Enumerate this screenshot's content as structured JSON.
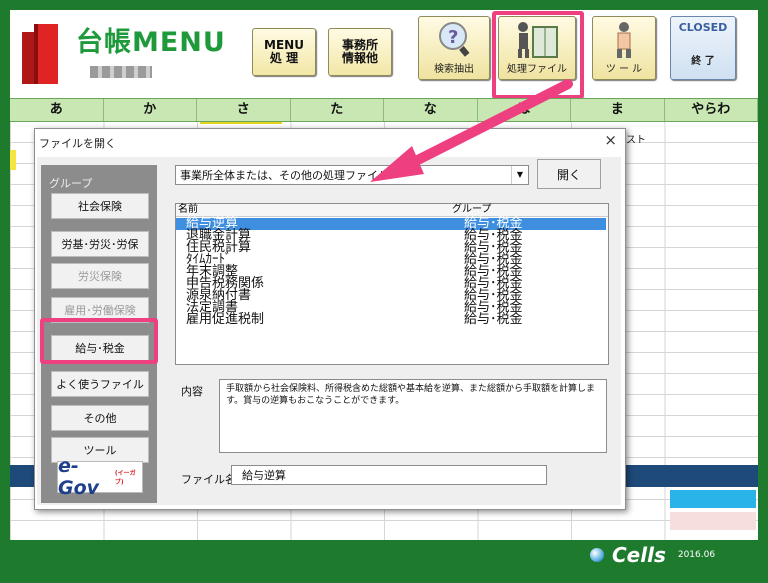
{
  "app": {
    "title": "台帳MENU"
  },
  "toolbar": {
    "menu_label": "MENU\n処 理",
    "office_label": "事務所\n情報他",
    "search_label": "検索抽出",
    "files_label": "処理ファイル",
    "tools_label": "ツ ー ル",
    "closed_label": "CLOSED",
    "exit_label": "終 了"
  },
  "kana_tabs": [
    "あ",
    "か",
    "さ",
    "た",
    "な",
    "は",
    "ま",
    "やらわ"
  ],
  "grid": {
    "partial_text": "スト"
  },
  "dialog": {
    "title": "ファイルを開く",
    "close": "×",
    "group_label": "グループ",
    "groups": [
      {
        "label": "社会保険",
        "enabled": true
      },
      {
        "label": "労基･労災･労保",
        "enabled": true
      },
      {
        "label": "労災保険",
        "enabled": false
      },
      {
        "label": "雇用･労働保険",
        "enabled": false
      },
      {
        "label": "給与･税金",
        "enabled": true,
        "selected": true
      },
      {
        "label": "よく使うファイル",
        "enabled": true
      },
      {
        "label": "その他",
        "enabled": true
      },
      {
        "label": "ツール",
        "enabled": true
      }
    ],
    "egov_text": "e-Gov",
    "egov_sup": "(イーガブ)",
    "combo_value": "事業所全体または、その他の処理ファイル",
    "combo_arrow": "▼",
    "open_button": "開く",
    "list": {
      "col_name": "名前",
      "col_group": "グループ",
      "rows": [
        {
          "name": "給与逆算",
          "group": "給与･税金",
          "selected": true
        },
        {
          "name": "退職金計算",
          "group": "給与･税金"
        },
        {
          "name": "住民税計算",
          "group": "給与･税金"
        },
        {
          "name": "ﾀｲﾑｶｰﾄﾞ",
          "group": "給与･税金"
        },
        {
          "name": "年末調整",
          "group": "給与･税金"
        },
        {
          "name": "申告税務関係",
          "group": "給与･税金"
        },
        {
          "name": "源泉納付書",
          "group": "給与･税金"
        },
        {
          "name": "法定調書",
          "group": "給与･税金"
        },
        {
          "name": "雇用促進税制",
          "group": "給与･税金"
        }
      ]
    },
    "desc_label": "内容",
    "description": "手取額から社会保険料、所得税含めた総額や基本給を逆算、また総額から手取額を計算します。賞与の逆算もおこなうことができます。",
    "filename_label": "ファイル名",
    "filename_value": "給与逆算"
  },
  "footer": {
    "brand": "Cells",
    "version": "2016.06"
  },
  "colors": {
    "brand_green": "#1e7b2e",
    "highlight": "#ee3f80",
    "selection": "#3f8fe0",
    "navy": "#1e4a7a"
  }
}
